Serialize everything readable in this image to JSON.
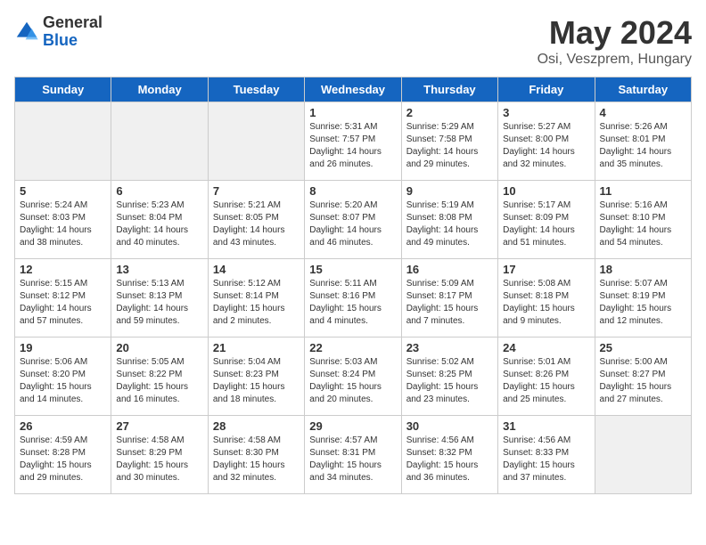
{
  "header": {
    "logo_general": "General",
    "logo_blue": "Blue",
    "month": "May 2024",
    "location": "Osi, Veszprem, Hungary"
  },
  "weekdays": [
    "Sunday",
    "Monday",
    "Tuesday",
    "Wednesday",
    "Thursday",
    "Friday",
    "Saturday"
  ],
  "weeks": [
    [
      {
        "day": "",
        "detail": ""
      },
      {
        "day": "",
        "detail": ""
      },
      {
        "day": "",
        "detail": ""
      },
      {
        "day": "1",
        "detail": "Sunrise: 5:31 AM\nSunset: 7:57 PM\nDaylight: 14 hours\nand 26 minutes."
      },
      {
        "day": "2",
        "detail": "Sunrise: 5:29 AM\nSunset: 7:58 PM\nDaylight: 14 hours\nand 29 minutes."
      },
      {
        "day": "3",
        "detail": "Sunrise: 5:27 AM\nSunset: 8:00 PM\nDaylight: 14 hours\nand 32 minutes."
      },
      {
        "day": "4",
        "detail": "Sunrise: 5:26 AM\nSunset: 8:01 PM\nDaylight: 14 hours\nand 35 minutes."
      }
    ],
    [
      {
        "day": "5",
        "detail": "Sunrise: 5:24 AM\nSunset: 8:03 PM\nDaylight: 14 hours\nand 38 minutes."
      },
      {
        "day": "6",
        "detail": "Sunrise: 5:23 AM\nSunset: 8:04 PM\nDaylight: 14 hours\nand 40 minutes."
      },
      {
        "day": "7",
        "detail": "Sunrise: 5:21 AM\nSunset: 8:05 PM\nDaylight: 14 hours\nand 43 minutes."
      },
      {
        "day": "8",
        "detail": "Sunrise: 5:20 AM\nSunset: 8:07 PM\nDaylight: 14 hours\nand 46 minutes."
      },
      {
        "day": "9",
        "detail": "Sunrise: 5:19 AM\nSunset: 8:08 PM\nDaylight: 14 hours\nand 49 minutes."
      },
      {
        "day": "10",
        "detail": "Sunrise: 5:17 AM\nSunset: 8:09 PM\nDaylight: 14 hours\nand 51 minutes."
      },
      {
        "day": "11",
        "detail": "Sunrise: 5:16 AM\nSunset: 8:10 PM\nDaylight: 14 hours\nand 54 minutes."
      }
    ],
    [
      {
        "day": "12",
        "detail": "Sunrise: 5:15 AM\nSunset: 8:12 PM\nDaylight: 14 hours\nand 57 minutes."
      },
      {
        "day": "13",
        "detail": "Sunrise: 5:13 AM\nSunset: 8:13 PM\nDaylight: 14 hours\nand 59 minutes."
      },
      {
        "day": "14",
        "detail": "Sunrise: 5:12 AM\nSunset: 8:14 PM\nDaylight: 15 hours\nand 2 minutes."
      },
      {
        "day": "15",
        "detail": "Sunrise: 5:11 AM\nSunset: 8:16 PM\nDaylight: 15 hours\nand 4 minutes."
      },
      {
        "day": "16",
        "detail": "Sunrise: 5:09 AM\nSunset: 8:17 PM\nDaylight: 15 hours\nand 7 minutes."
      },
      {
        "day": "17",
        "detail": "Sunrise: 5:08 AM\nSunset: 8:18 PM\nDaylight: 15 hours\nand 9 minutes."
      },
      {
        "day": "18",
        "detail": "Sunrise: 5:07 AM\nSunset: 8:19 PM\nDaylight: 15 hours\nand 12 minutes."
      }
    ],
    [
      {
        "day": "19",
        "detail": "Sunrise: 5:06 AM\nSunset: 8:20 PM\nDaylight: 15 hours\nand 14 minutes."
      },
      {
        "day": "20",
        "detail": "Sunrise: 5:05 AM\nSunset: 8:22 PM\nDaylight: 15 hours\nand 16 minutes."
      },
      {
        "day": "21",
        "detail": "Sunrise: 5:04 AM\nSunset: 8:23 PM\nDaylight: 15 hours\nand 18 minutes."
      },
      {
        "day": "22",
        "detail": "Sunrise: 5:03 AM\nSunset: 8:24 PM\nDaylight: 15 hours\nand 20 minutes."
      },
      {
        "day": "23",
        "detail": "Sunrise: 5:02 AM\nSunset: 8:25 PM\nDaylight: 15 hours\nand 23 minutes."
      },
      {
        "day": "24",
        "detail": "Sunrise: 5:01 AM\nSunset: 8:26 PM\nDaylight: 15 hours\nand 25 minutes."
      },
      {
        "day": "25",
        "detail": "Sunrise: 5:00 AM\nSunset: 8:27 PM\nDaylight: 15 hours\nand 27 minutes."
      }
    ],
    [
      {
        "day": "26",
        "detail": "Sunrise: 4:59 AM\nSunset: 8:28 PM\nDaylight: 15 hours\nand 29 minutes."
      },
      {
        "day": "27",
        "detail": "Sunrise: 4:58 AM\nSunset: 8:29 PM\nDaylight: 15 hours\nand 30 minutes."
      },
      {
        "day": "28",
        "detail": "Sunrise: 4:58 AM\nSunset: 8:30 PM\nDaylight: 15 hours\nand 32 minutes."
      },
      {
        "day": "29",
        "detail": "Sunrise: 4:57 AM\nSunset: 8:31 PM\nDaylight: 15 hours\nand 34 minutes."
      },
      {
        "day": "30",
        "detail": "Sunrise: 4:56 AM\nSunset: 8:32 PM\nDaylight: 15 hours\nand 36 minutes."
      },
      {
        "day": "31",
        "detail": "Sunrise: 4:56 AM\nSunset: 8:33 PM\nDaylight: 15 hours\nand 37 minutes."
      },
      {
        "day": "",
        "detail": ""
      }
    ]
  ]
}
